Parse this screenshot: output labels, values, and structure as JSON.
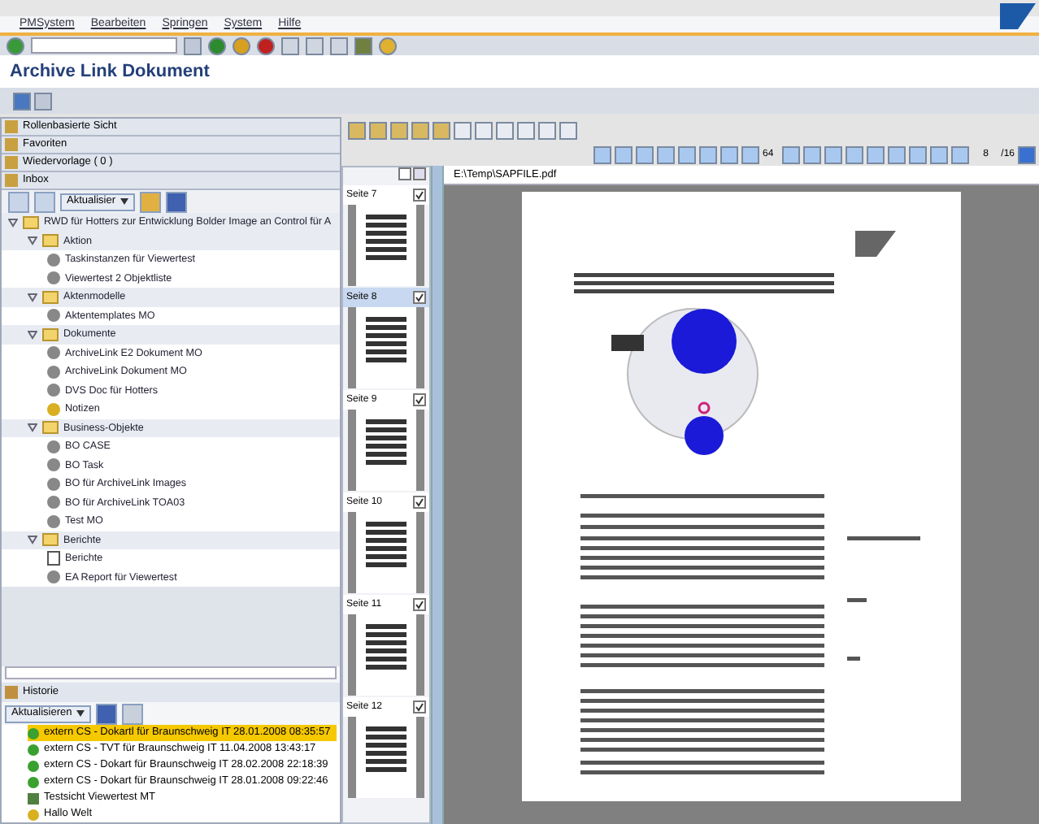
{
  "menu": [
    "PMSystem",
    "Bearbeiten",
    "Springen",
    "System",
    "Hilfe"
  ],
  "title": "Archive Link Dokument",
  "panels": [
    {
      "label": "Rollenbasierte Sicht"
    },
    {
      "label": "Favoriten"
    },
    {
      "label": "Wiedervorlage ( 0 )"
    },
    {
      "label": "Inbox"
    }
  ],
  "tree_toolbar": {
    "button": "Aktualisier"
  },
  "tree": [
    {
      "label": "RWD für Hotters zur Entwicklung Bolder Image an Control für A",
      "expanded": true,
      "children": [
        {
          "label": "Aktion",
          "expanded": true,
          "children": [
            {
              "label": "Taskinstanzen für Viewertest",
              "kind": "item"
            },
            {
              "label": "Viewertest 2 Objektliste",
              "kind": "item"
            }
          ]
        },
        {
          "label": "Aktenmodelle",
          "expanded": true,
          "children": [
            {
              "label": "Aktentemplates MO",
              "kind": "item"
            }
          ]
        },
        {
          "label": "Dokumente",
          "expanded": true,
          "children": [
            {
              "label": "ArchiveLink E2 Dokument MO",
              "kind": "item"
            },
            {
              "label": "ArchiveLink Dokument MO",
              "kind": "item"
            },
            {
              "label": "DVS Doc für Hotters",
              "kind": "item"
            },
            {
              "label": "Notizen",
              "kind": "note"
            }
          ]
        },
        {
          "label": "Business-Objekte",
          "expanded": true,
          "children": [
            {
              "label": "BO CASE",
              "kind": "item"
            },
            {
              "label": "BO Task",
              "kind": "item"
            },
            {
              "label": "BO für ArchiveLink Images",
              "kind": "item"
            },
            {
              "label": "BO für ArchiveLink TOA03",
              "kind": "item"
            },
            {
              "label": "Test MO",
              "kind": "item"
            }
          ]
        },
        {
          "label": "Berichte",
          "expanded": true,
          "children": [
            {
              "label": "Berichte",
              "kind": "report"
            },
            {
              "label": "EA Report für Viewertest",
              "kind": "item"
            }
          ]
        }
      ]
    }
  ],
  "history": {
    "title": "Historie",
    "button": "Aktualisieren",
    "items": [
      {
        "label": "extern CS - Dokartl für Braunschweig IT 28.01.2008 08:35:57",
        "kind": "status",
        "selected": true
      },
      {
        "label": "extern CS - TVT für Braunschweig IT 11.04.2008 13:43:17",
        "kind": "status",
        "selected": false
      },
      {
        "label": "extern CS - Dokart für Braunschweig IT 28.02.2008 22:18:39",
        "kind": "status",
        "selected": false
      },
      {
        "label": "extern CS - Dokart für Braunschweig IT 28.01.2008 09:22:46",
        "kind": "status",
        "selected": false
      },
      {
        "label": "Testsicht Viewertest MT",
        "kind": "view",
        "selected": false
      },
      {
        "label": "Hallo Welt",
        "kind": "note",
        "selected": false
      }
    ]
  },
  "viewer": {
    "zoom": "64",
    "page": "8",
    "page_count": "/16",
    "path": "E:\\Temp\\SAPFILE.pdf",
    "thumbnails": [
      {
        "label": "Seite 7",
        "selected": false,
        "checked": true
      },
      {
        "label": "Seite 8",
        "selected": true,
        "checked": true
      },
      {
        "label": "Seite 9",
        "selected": false,
        "checked": true
      },
      {
        "label": "Seite 10",
        "selected": false,
        "checked": true
      },
      {
        "label": "Seite 11",
        "selected": false,
        "checked": true
      },
      {
        "label": "Seite 12",
        "selected": false,
        "checked": true
      }
    ]
  }
}
